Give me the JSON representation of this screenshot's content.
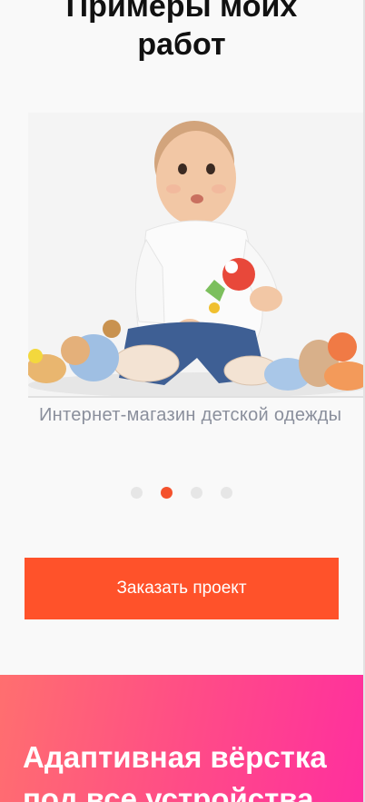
{
  "portfolio": {
    "title_line1": "Примеры моих",
    "title_line2": "работ",
    "slide": {
      "caption": "Интернет-магазин детской одежды"
    },
    "pagination": {
      "count": 4,
      "active_index": 1
    },
    "order_button_label": "Заказать проект"
  },
  "promo": {
    "title_line1": "Адаптивная вёрстка",
    "title_line2": "под все устройства"
  },
  "colors": {
    "accent": "#ff522a",
    "dot_inactive": "#e6e6e6",
    "caption": "#8a8f9c",
    "gradient_start": "#ff6f6f",
    "gradient_end": "#ff2f9e"
  },
  "icons": {
    "slide_image": "baby-with-toys-photo"
  }
}
